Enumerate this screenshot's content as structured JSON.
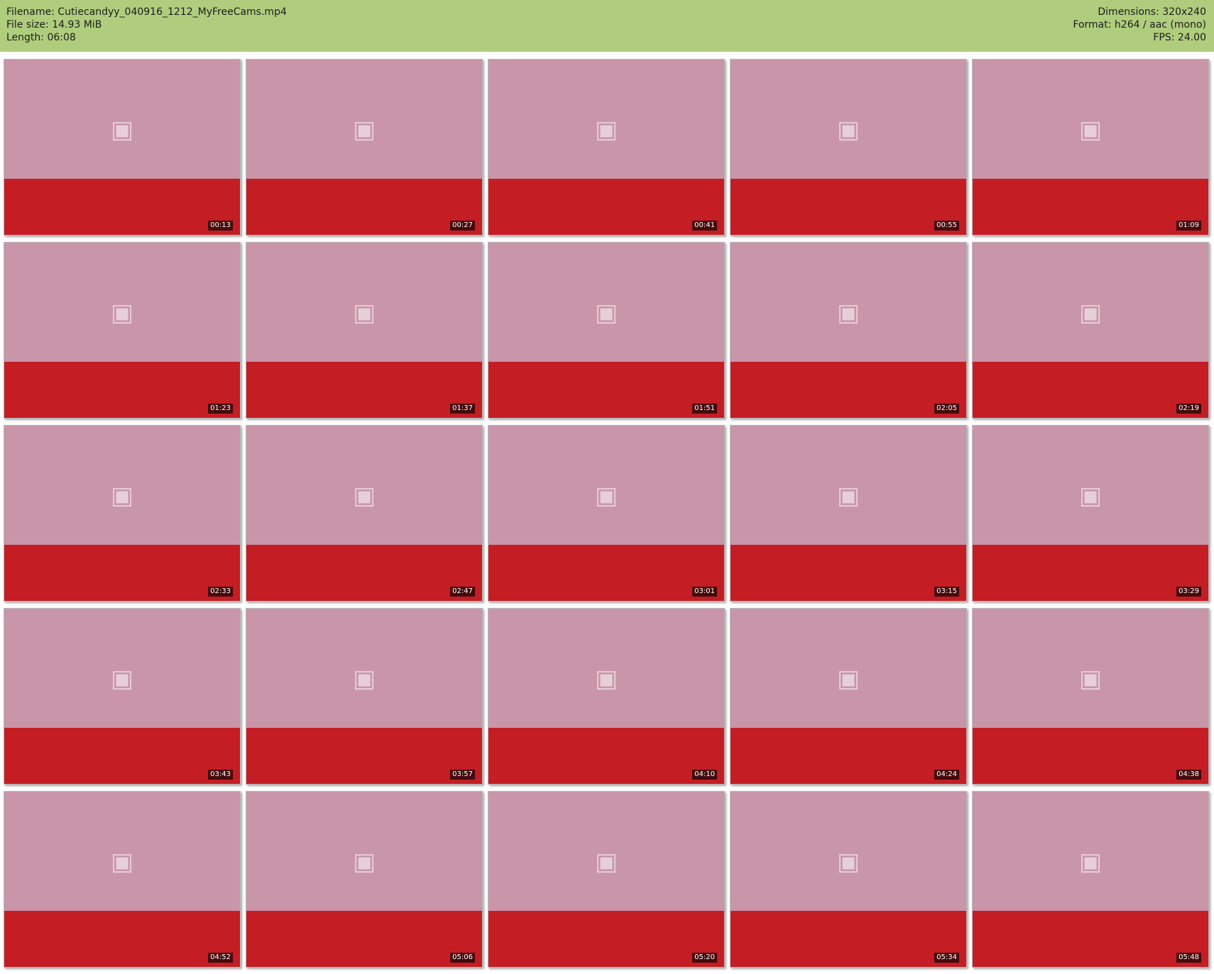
{
  "header": {
    "filename": "Filename: Cutiecandyy_040916_1212_MyFreeCams.mp4",
    "filesize": "File size: 14.93 MiB",
    "length": "Length: 06:08",
    "dimensions": "Dimensions: 320x240",
    "format": "Format: h264 / aac (mono)",
    "fps": "FPS: 24.00"
  },
  "colors": {
    "header_bg": "#b0cd7d",
    "thumb_wall": "#c995a8",
    "thumb_floor": "#c41d24"
  },
  "thumb_icon": "image-placeholder-icon",
  "thumbnails": [
    "00:13",
    "00:27",
    "00:41",
    "00:55",
    "01:09",
    "01:23",
    "01:37",
    "01:51",
    "02:05",
    "02:19",
    "02:33",
    "02:47",
    "03:01",
    "03:15",
    "03:29",
    "03:43",
    "03:57",
    "04:10",
    "04:24",
    "04:38",
    "04:52",
    "05:06",
    "05:20",
    "05:34",
    "05:48"
  ]
}
